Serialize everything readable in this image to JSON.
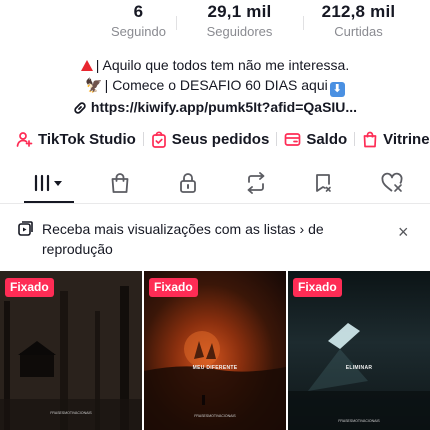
{
  "stats": [
    {
      "value": "6",
      "label": "Seguindo"
    },
    {
      "value": "29,1 mil",
      "label": "Seguidores"
    },
    {
      "value": "212,8 mil",
      "label": "Curtidas"
    }
  ],
  "bio": {
    "line1": "| Aquilo que todos tem não me interessa.",
    "line2": "| Comece o DESAFIO 60 DIAS aqui",
    "bird_emoji": "🦅",
    "down_emoji": "⬇"
  },
  "link": {
    "text": "https://kiwify.app/pumk5It?afid=QaSIU..."
  },
  "quick_links": [
    {
      "label": "TikTok Studio",
      "icon": "person-plus-icon"
    },
    {
      "label": "Seus pedidos",
      "icon": "order-bag-icon"
    },
    {
      "label": "Saldo",
      "icon": "wallet-icon"
    },
    {
      "label": "Vitrine",
      "icon": "shop-bag-icon"
    }
  ],
  "tabs": [
    {
      "name": "videos-grid",
      "icon": "grid-bars-icon"
    },
    {
      "name": "shop",
      "icon": "shopping-bag-icon"
    },
    {
      "name": "private",
      "icon": "lock-icon"
    },
    {
      "name": "reposts",
      "icon": "repost-icon"
    },
    {
      "name": "favorites",
      "icon": "bookmark-icon"
    },
    {
      "name": "liked",
      "icon": "heart-icon"
    }
  ],
  "banner": {
    "text": "Receba mais visualizações com as listas  ›  de reprodução",
    "close": "×"
  },
  "videos": [
    {
      "pinned_label": "Fixado",
      "caption": "",
      "footer": "FRASESMOTIVACIONAIS"
    },
    {
      "pinned_label": "Fixado",
      "caption": "MEU DIFERENTE",
      "footer": "FRASESMOTIVACIONAIS"
    },
    {
      "pinned_label": "Fixado",
      "caption": "ELIMINAR",
      "footer": "FRASESMOTIVACIONAIS"
    }
  ],
  "colors": {
    "accent_pink": "#fe2c55",
    "text": "#161823",
    "muted": "#8a8b91"
  }
}
